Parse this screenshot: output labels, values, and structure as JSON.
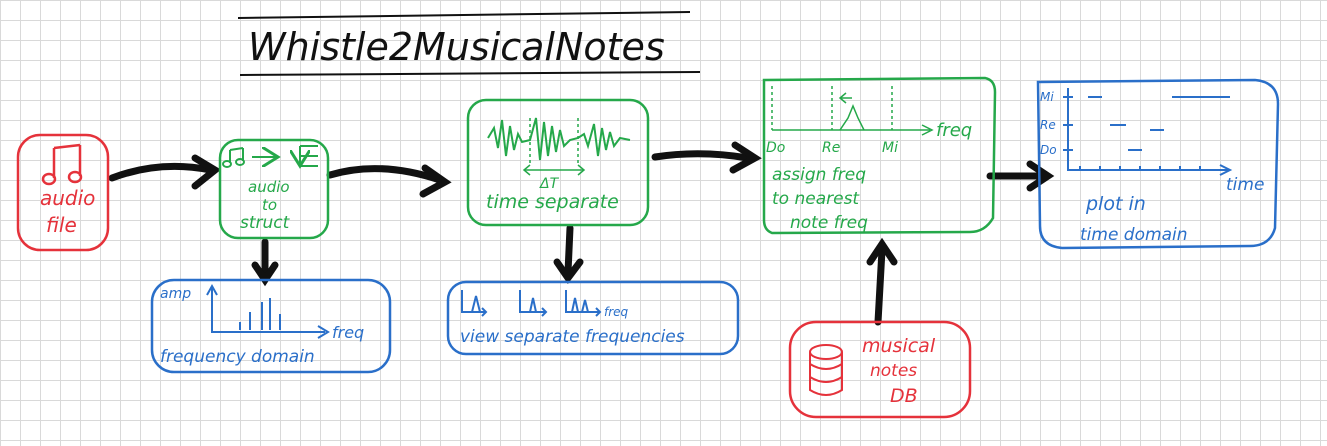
{
  "title": "Whistle2MusicalNotes",
  "colors": {
    "red": "#e5323b",
    "green": "#25a84a",
    "blue": "#2a6fc9",
    "black": "#111111",
    "grid": "#d9d9d9"
  },
  "nodes": {
    "audio_file": {
      "line1": "audio",
      "line2": "file",
      "icon": "music-note-icon"
    },
    "audio_to_struct": {
      "line1": "audio",
      "line2": "to",
      "line3": "struct"
    },
    "frequency_domain": {
      "ylabel": "amp",
      "xlabel": "freq",
      "caption": "frequency domain"
    },
    "time_separate": {
      "dt_label": "ΔT",
      "caption": "time separate"
    },
    "view_separate": {
      "xlabel": "freq",
      "caption": "view separate frequencies"
    },
    "assign_freq": {
      "ticks": [
        "Do",
        "Re",
        "Mi"
      ],
      "xlabel": "freq",
      "line1": "assign freq",
      "line2": "to nearest",
      "line3": "note freq"
    },
    "musical_notes_db": {
      "line1": "musical",
      "line2": "notes",
      "line3": "DB",
      "icon": "database-icon"
    },
    "plot_time": {
      "yticks": [
        "Mi",
        "Re",
        "Do"
      ],
      "xlabel": "time",
      "line1": "plot in",
      "line2": "time domain"
    }
  }
}
